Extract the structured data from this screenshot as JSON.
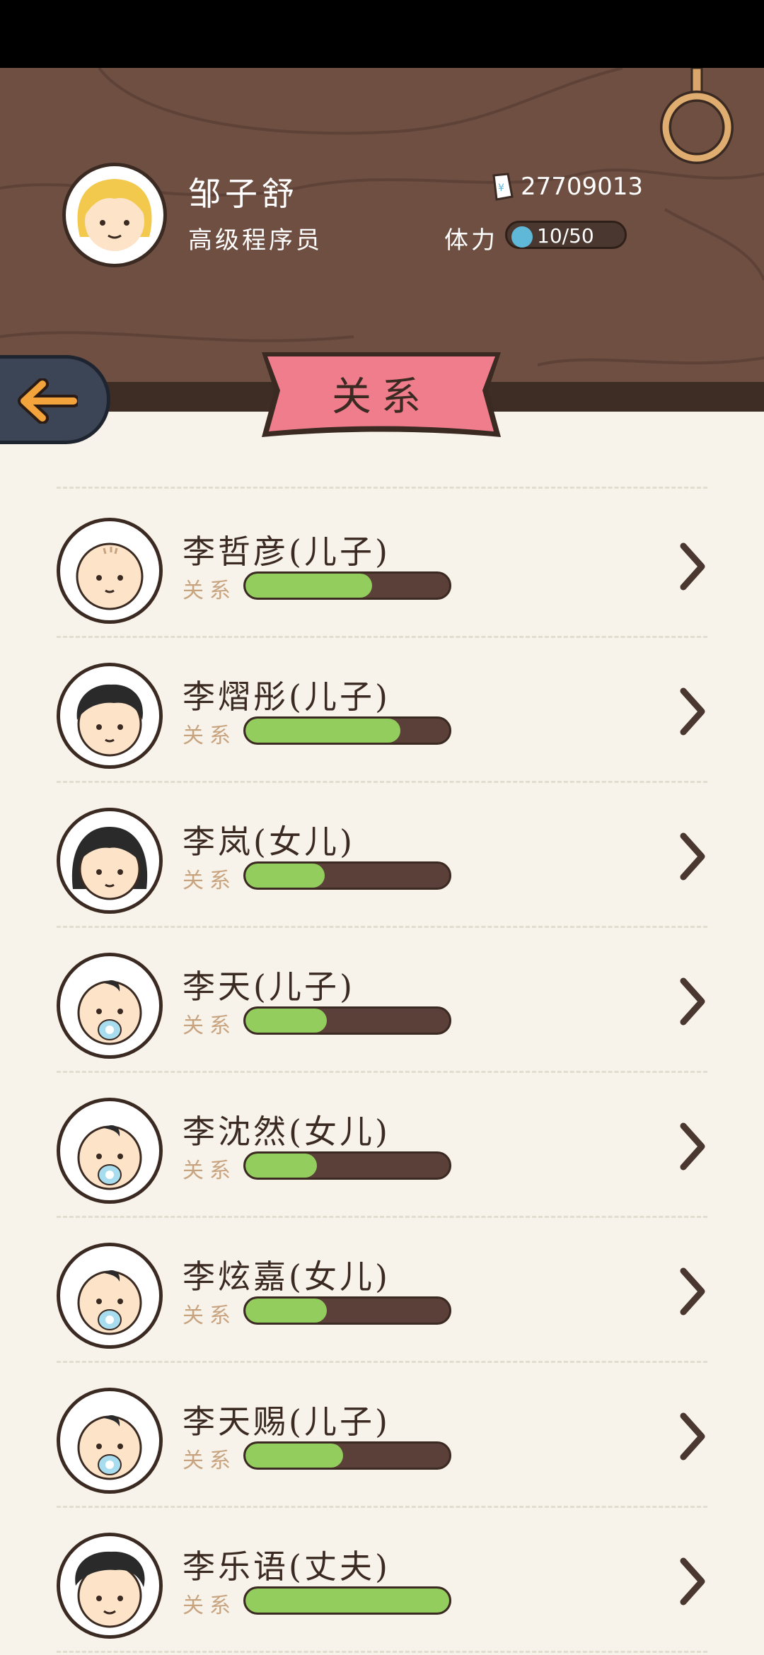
{
  "player": {
    "name": "邹子舒",
    "title": "高级程序员",
    "money": "27709013",
    "stamina_label": "体力",
    "stamina": "10/50"
  },
  "page_title": "关系",
  "relations": [
    {
      "name": "李哲彦(儿子)",
      "label": "关系",
      "progress": 0.62,
      "avatar": "bald-baby"
    },
    {
      "name": "李熠彤(儿子)",
      "label": "关系",
      "progress": 0.76,
      "avatar": "boy"
    },
    {
      "name": "李岚(女儿)",
      "label": "关系",
      "progress": 0.39,
      "avatar": "girl"
    },
    {
      "name": "李天(儿子)",
      "label": "关系",
      "progress": 0.4,
      "avatar": "infant-pacifier"
    },
    {
      "name": "李沈然(女儿)",
      "label": "关系",
      "progress": 0.35,
      "avatar": "infant-pacifier"
    },
    {
      "name": "李炫嘉(女儿)",
      "label": "关系",
      "progress": 0.4,
      "avatar": "infant-pacifier"
    },
    {
      "name": "李天赐(儿子)",
      "label": "关系",
      "progress": 0.48,
      "avatar": "infant-pacifier"
    },
    {
      "name": "李乐语(丈夫)",
      "label": "关系",
      "progress": 1.0,
      "avatar": "man"
    }
  ],
  "colors": {
    "wood": "#6e4f42",
    "bar_fill": "#93cd5e",
    "bar_bg": "#5a4038",
    "ribbon": "#f07d8c",
    "background": "#f7f3ea"
  }
}
